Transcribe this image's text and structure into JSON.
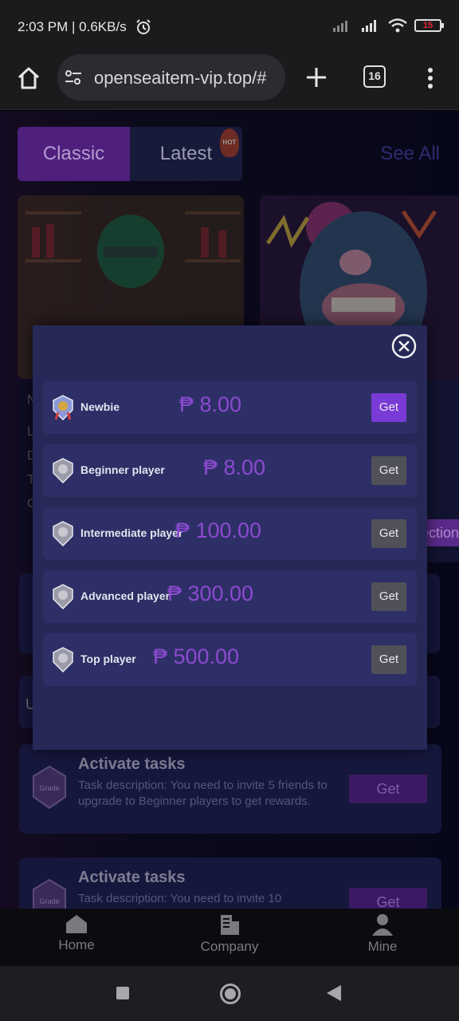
{
  "status_bar": {
    "time_speed": "2:03 PM | 0.6KB/s",
    "battery": "15",
    "icons": [
      "alarm-icon",
      "signal-icon",
      "wifi-icon",
      "battery-icon"
    ]
  },
  "browser": {
    "url": "openseaitem-vip.top/#",
    "tab_count": "16",
    "icons": [
      "home-icon",
      "tune-icon",
      "plus-icon",
      "tabs-icon",
      "more-vert-icon"
    ]
  },
  "background_page": {
    "tabs": [
      {
        "label": "Classic"
      },
      {
        "label": "Latest"
      }
    ],
    "hot_badge": "HOT",
    "see_all": "See All",
    "card_side_letters": [
      "N",
      "L",
      "D",
      "T",
      "C"
    ],
    "collect_partial": "ection",
    "block_b_char": "U",
    "tasks": [
      {
        "title": "Activate tasks",
        "description": "Task description: You need to invite 5 friends to upgrade to Beginner players to get rewards.",
        "badge": "Grade",
        "button": "Get"
      },
      {
        "title": "Activate tasks",
        "description": "Task description: You need to invite 10",
        "badge": "Grade",
        "button": "Get"
      }
    ]
  },
  "bottom_nav": [
    {
      "label": "Home",
      "icon": "home-icon"
    },
    {
      "label": "Company",
      "icon": "building-icon"
    },
    {
      "label": "Mine",
      "icon": "person-icon"
    }
  ],
  "modal": {
    "close_icon": "close-circle-icon",
    "levels": [
      {
        "name": "Newbie",
        "amount": "₱ 8.00",
        "button": "Get",
        "active": true,
        "accent": "#7a3ad6"
      },
      {
        "name": "Beginner player",
        "amount": "₱ 8.00",
        "button": "Get",
        "active": false,
        "accent": "#505058"
      },
      {
        "name": "Intermediate player",
        "amount": "₱ 100.00",
        "button": "Get",
        "active": false,
        "accent": "#505058"
      },
      {
        "name": "Advanced player",
        "amount": "₱ 300.00",
        "button": "Get",
        "active": false,
        "accent": "#505058"
      },
      {
        "name": "Top player",
        "amount": "₱ 500.00",
        "button": "Get",
        "active": false,
        "accent": "#505058"
      }
    ]
  },
  "colors": {
    "modal_bg": "#262858",
    "row_bg": "#2d2f66",
    "amount": "#8c4ad0",
    "active_button": "#7a3ad6",
    "inactive_button": "#505058"
  }
}
